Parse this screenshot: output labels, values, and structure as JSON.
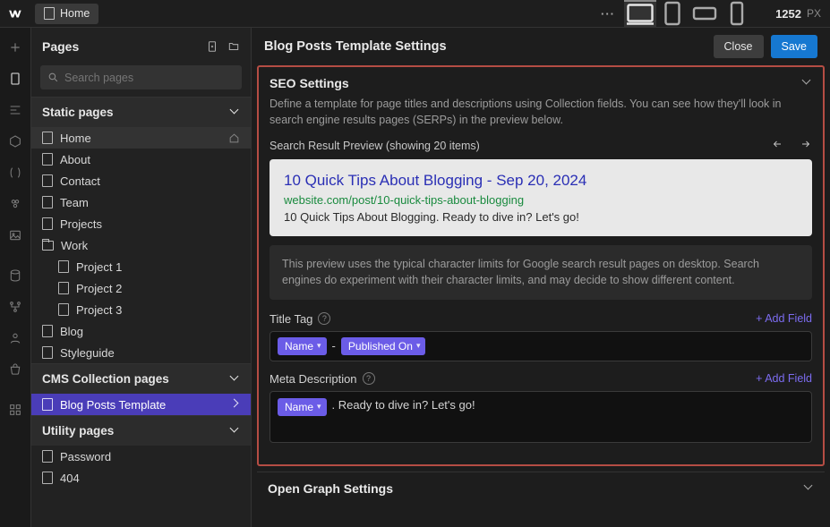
{
  "topbar": {
    "breadcrumb_label": "Home",
    "viewport_width": "1252",
    "viewport_unit": "PX"
  },
  "panel": {
    "title": "Pages",
    "search_placeholder": "Search pages",
    "sections": {
      "static": "Static pages",
      "cms": "CMS Collection pages",
      "utility": "Utility pages"
    },
    "static_items": [
      "Home",
      "About",
      "Contact",
      "Team",
      "Projects",
      "Work",
      "Project 1",
      "Project 2",
      "Project 3",
      "Blog",
      "Styleguide"
    ],
    "cms_items": [
      "Blog Posts Template"
    ],
    "utility_items": [
      "Password",
      "404"
    ]
  },
  "settings": {
    "header": "Blog Posts Template Settings",
    "close": "Close",
    "save": "Save",
    "seo": {
      "title": "SEO Settings",
      "desc": "Define a template for page titles and descriptions using Collection fields. You can see how they'll look in search engine results pages (SERPs) in the preview below.",
      "preview_label": "Search Result Preview (showing 20 items)",
      "serp": {
        "title": "10 Quick Tips About Blogging - Sep 20, 2024",
        "url": "website.com/post/10-quick-tips-about-blogging",
        "snippet": "10 Quick Tips About Blogging. Ready to dive in? Let's go!"
      },
      "note": "This preview uses the typical character limits for Google search result pages on desktop. Search engines do experiment with their character limits, and may decide to show different content.",
      "title_tag_label": "Title Tag",
      "add_field": "+ Add Field",
      "title_chip1": "Name",
      "title_sep": "-",
      "title_chip2": "Published On",
      "meta_label": "Meta Description",
      "meta_chip": "Name",
      "meta_text": ". Ready to dive in? Let's go!"
    },
    "og_title": "Open Graph Settings"
  }
}
